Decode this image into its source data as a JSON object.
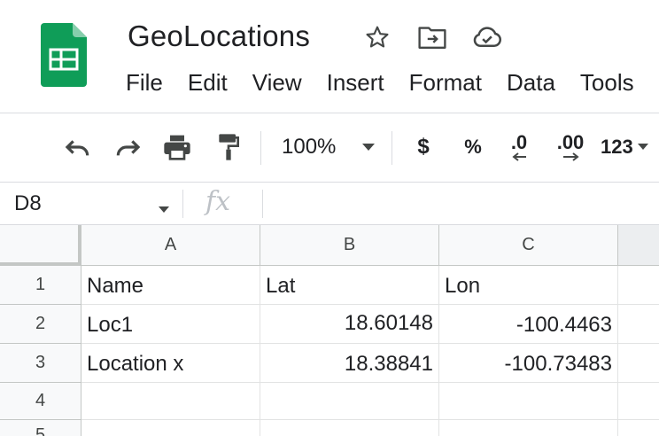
{
  "document": {
    "title": "GeoLocations",
    "title_icons": [
      "star-icon",
      "move-to-folder-icon",
      "cloud-saved-icon"
    ]
  },
  "menu": [
    "File",
    "Edit",
    "View",
    "Insert",
    "Format",
    "Data",
    "Tools"
  ],
  "toolbar": {
    "zoom": "100%",
    "currency": "$",
    "percent": "%",
    "decrease_decimal": ".0",
    "increase_decimal": ".00",
    "more_formats": "123"
  },
  "formula_bar": {
    "name_box": "D8",
    "fx_label": "fx",
    "value": ""
  },
  "grid": {
    "columns": [
      "A",
      "B",
      "C"
    ],
    "rows": [
      "1",
      "2",
      "3",
      "4",
      "5"
    ],
    "cells": [
      [
        "Name",
        "Lat",
        "Lon"
      ],
      [
        "Loc1",
        "18.60148",
        "-100.4463"
      ],
      [
        "Location x",
        "18.38841",
        "-100.73483"
      ],
      [
        "",
        "",
        ""
      ],
      [
        "",
        "",
        ""
      ]
    ]
  },
  "colors": {
    "sheets_green": "#0F9D58",
    "sheets_green_dark": "#0B8043",
    "header_bg": "#F8F9FA",
    "grid_line": "#E2E3E3"
  }
}
